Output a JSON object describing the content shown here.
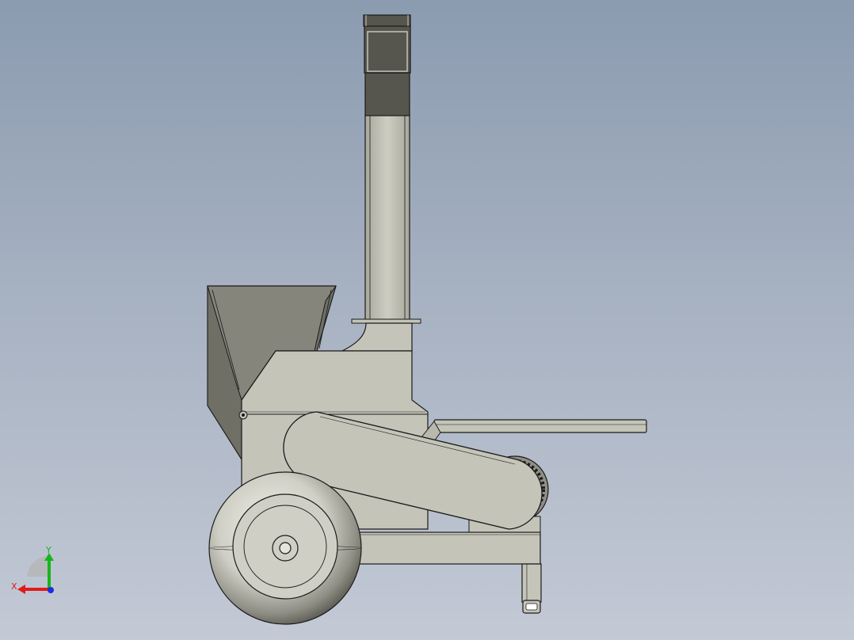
{
  "colors": {
    "background_top": "#8b9bb0",
    "background_bottom": "#c3c9d5",
    "body_fill": "#c4c4b9",
    "dark_fill": "#56564e",
    "hopper_fill": "#85857c",
    "outline": "#1a1a1a",
    "axis_x": "#e01b1b",
    "axis_y": "#17b51c",
    "axis_z": "#1b2fe0"
  },
  "triad": {
    "x_label": "X",
    "y_label": "Y"
  }
}
